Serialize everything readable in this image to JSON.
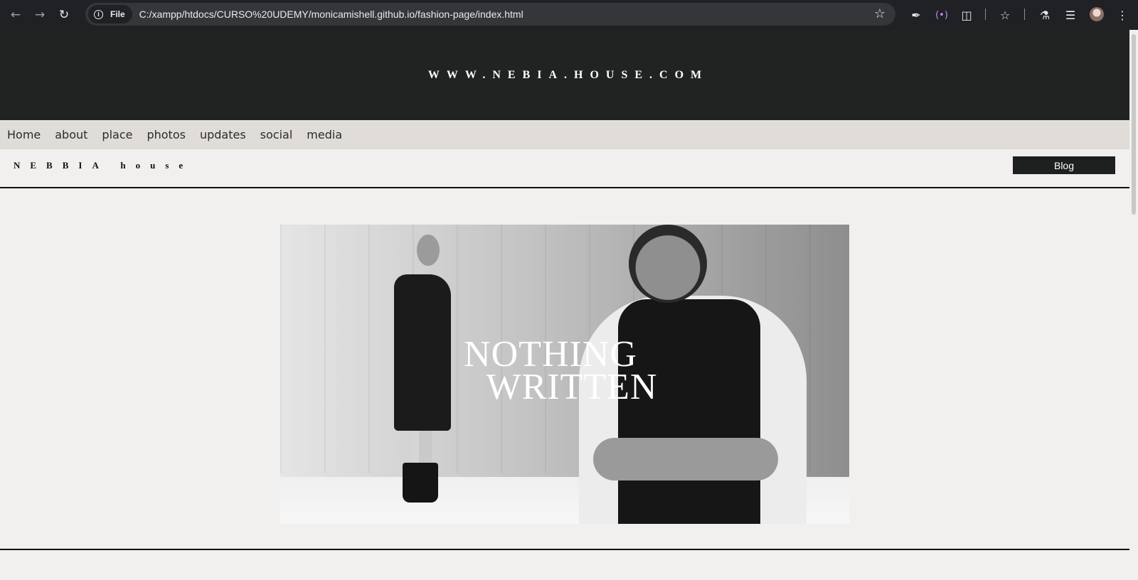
{
  "browser": {
    "back_icon": "arrow-left-icon",
    "forward_icon": "arrow-right-icon",
    "reload_icon": "reload-icon",
    "chip_label": "File",
    "url": "C:/xampp/htdocs/CURSO%20UDEMY/monicamishell.github.io/fashion-page/index.html"
  },
  "site": {
    "header_url": "WWW.NEBIA.HOUSE.COM",
    "nav": [
      "Home",
      "about",
      "place",
      "photos",
      "updates",
      "social",
      "media"
    ],
    "brand": "NEBBIA house",
    "blog_label": "Blog",
    "banner_line1": "NOTHING",
    "banner_line2": "WRITTEN"
  },
  "colors": {
    "header_bg": "#212323",
    "nav_bg": "#e0ddd9",
    "page_bg": "#f1f0ee",
    "button_bg": "#1e2020"
  }
}
